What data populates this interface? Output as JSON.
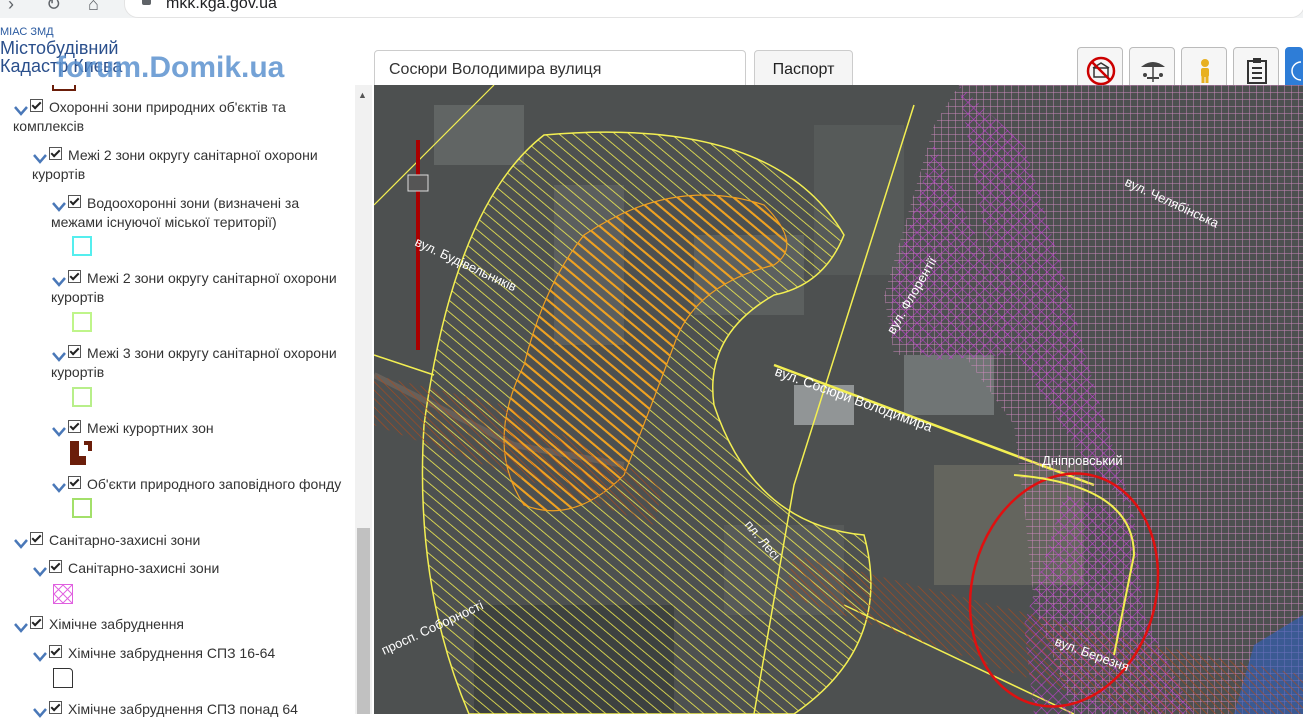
{
  "browser": {
    "url": "mkk.kga.gov.ua"
  },
  "header": {
    "logo_line1": "МІАС ЗМД",
    "logo_line2": "Містобудівний",
    "logo_line3": "Кадастр Києва",
    "watermark": "forum.Domik.ua",
    "search_value": "Сосюри Володимира вулиця",
    "passport_label": "Паспорт",
    "tools": [
      "no-kiosk-icon",
      "umbrella-cafe-icon",
      "person-icon",
      "clipboard-icon",
      "globe-icon"
    ]
  },
  "layers": [
    {
      "label1": "Охоронні зони природних об'єктів та",
      "label2": "комплексів"
    },
    {
      "label1": "Межі 2 зони округу санітарної охорони",
      "label2": "курортів"
    },
    {
      "label1": "Водоохоронні зони (визначені за",
      "label2": "межами існуючої міської території)"
    },
    {
      "label1": "Межі 2 зони округу санітарної охорони",
      "label2": "курортів"
    },
    {
      "label1": "Межі 3 зони округу санітарної охорони",
      "label2": "курортів"
    },
    {
      "label1": "Межі курортних зон",
      "label2": ""
    },
    {
      "label1": "Об'єкти природного заповідного фонду",
      "label2": ""
    },
    {
      "label1": "Санітарно-захисні зони",
      "label2": ""
    },
    {
      "label1": "Санітарно-захисні зони",
      "label2": ""
    },
    {
      "label1": "Хімічне забруднення",
      "label2": ""
    },
    {
      "label1": "Хімічне забруднення СПЗ 16-64",
      "label2": ""
    },
    {
      "label1": "Хімічне забруднення СПЗ понад 64",
      "label2": ""
    }
  ],
  "map_labels": {
    "street_sosiury": "вул. Сосюри Володимира",
    "street_budivelnykiv": "вул. Будівельників",
    "street_dniprovskyi": "Дніпровський",
    "street_sobornosti": "просп. Соборності",
    "street_lesi": "пл. Лесі",
    "street_yeverov": "вул. Березня",
    "street_right": "вул. Челябінська",
    "street_fleet": "вул. Флорентії"
  },
  "colors": {
    "water": "#55eeee",
    "zone2": "#bff58a",
    "zone3": "#b8ef8a",
    "resort": "#6b1e0a",
    "reserve": "#a3e06a",
    "sanitary": "#e060e0",
    "chem": "#333333",
    "yellow_hatch": "#f3ef52",
    "orange": "#f0a020"
  }
}
